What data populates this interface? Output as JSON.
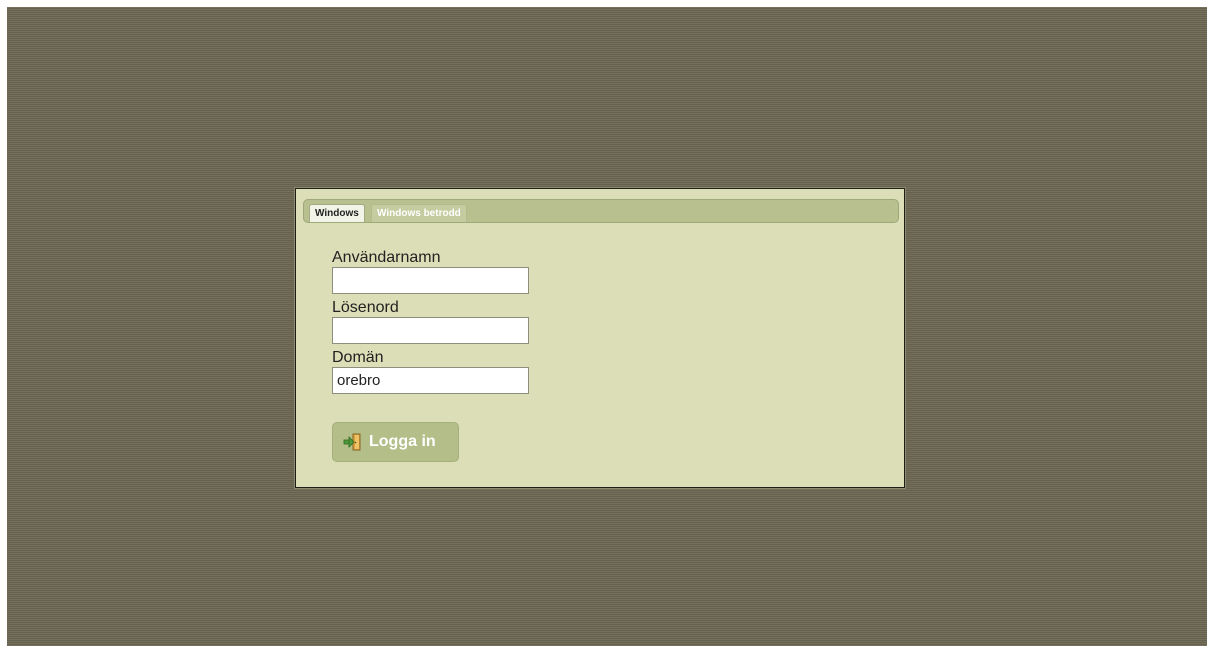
{
  "login": {
    "tabs": [
      {
        "label": "Windows",
        "active": true
      },
      {
        "label": "Windows betrodd",
        "active": false
      }
    ],
    "fields": {
      "username": {
        "label": "Användarnamn",
        "value": ""
      },
      "password": {
        "label": "Lösenord",
        "value": ""
      },
      "domain": {
        "label": "Domän",
        "value": "orebro"
      }
    },
    "button": {
      "label": "Logga in",
      "icon": "login-door-icon"
    }
  },
  "colors": {
    "backdrop": "#6f6a57",
    "panel": "#dcdeb7",
    "tabbar": "#b7c08e",
    "button": "#b3be88"
  }
}
